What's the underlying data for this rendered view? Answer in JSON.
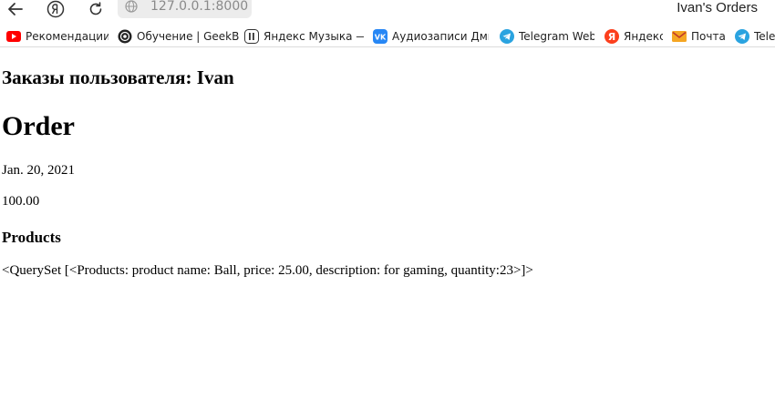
{
  "browser": {
    "address": "127.0.0.1:8000",
    "tab_title": "Ivan's Orders",
    "icons": {
      "back": "arrow-left-icon",
      "yandex": "yandex-logo-icon",
      "reload": "reload-icon",
      "site": "globe-icon"
    }
  },
  "bookmarks": [
    {
      "label": "Рекомендации",
      "icon": "youtube-icon"
    },
    {
      "label": "Обучение | GeekB",
      "icon": "geekbrains-icon"
    },
    {
      "label": "Яндекс Музыка —",
      "icon": "yandex-music-icon"
    },
    {
      "label": "Аудиозаписи Дми",
      "icon": "vk-icon"
    },
    {
      "label": "Telegram Web",
      "icon": "telegram-icon"
    },
    {
      "label": "Яндекс",
      "icon": "yandex-icon"
    },
    {
      "label": "Почта",
      "icon": "mail-icon"
    },
    {
      "label": "Teleg",
      "icon": "telegram-icon"
    }
  ],
  "page": {
    "user_heading": "Заказы пользователя: Ivan",
    "order_heading": "Order",
    "order_date": "Jan. 20, 2021",
    "order_total": "100.00",
    "products_heading": "Products",
    "products_queryset": "<QuerySet [<Products: product name: Ball, price: 25.00, description: for gaming, quantity:23>]>"
  },
  "colors": {
    "youtube": "#ff0000",
    "vk": "#2787f5",
    "telegram": "#2aa3e0",
    "yandex": "#fc3f1d",
    "mail": "#f5a623"
  }
}
